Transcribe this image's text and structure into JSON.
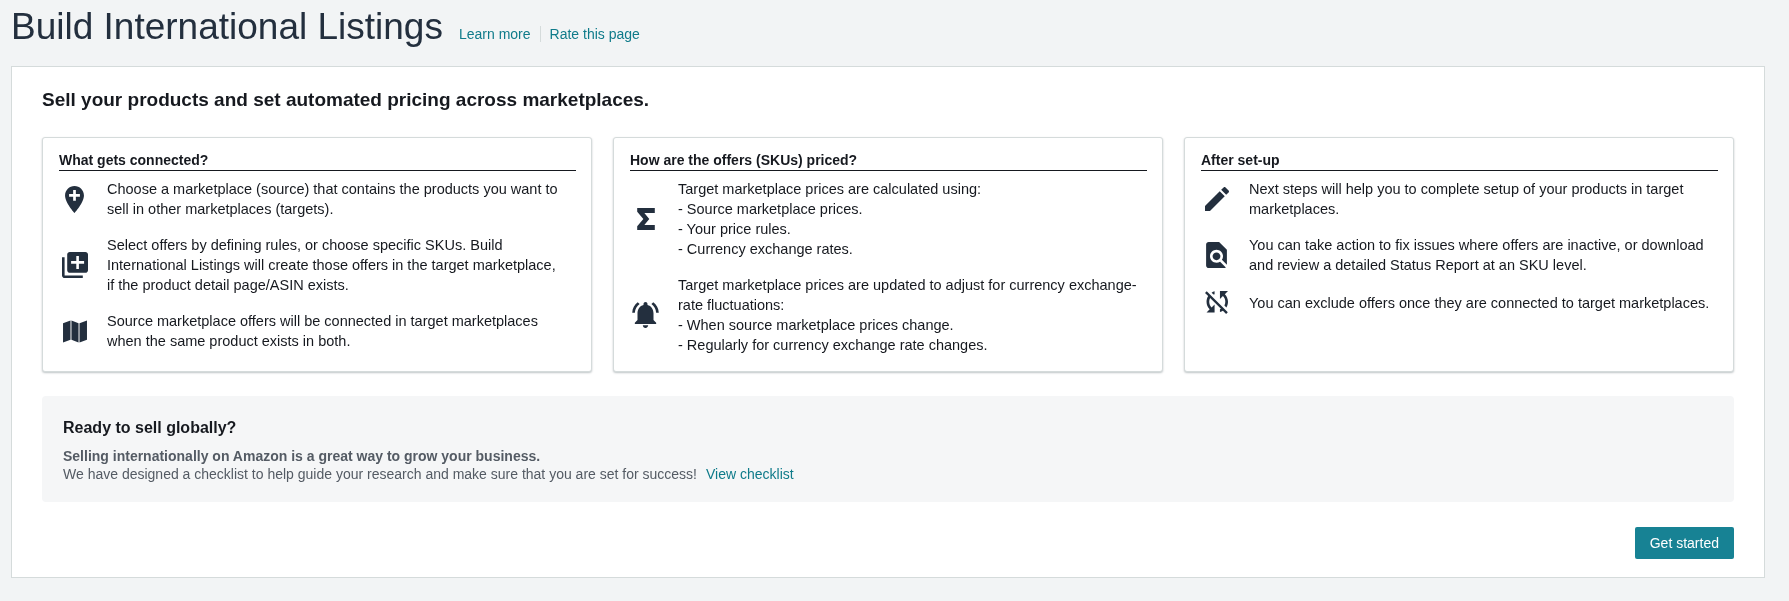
{
  "header": {
    "title": "Build International Listings",
    "links": [
      "Learn more",
      "Rate this page"
    ]
  },
  "panel": {
    "heading": "Sell your products and set automated pricing across marketplaces.",
    "cards": [
      {
        "title": "What gets connected?",
        "items": [
          {
            "text": "Choose a marketplace (source) that contains the products you want to sell in other marketplaces (targets)."
          },
          {
            "text": "Select offers by defining rules, or choose specific SKUs. Build International Listings will create those offers in the target marketplace, if the product detail page/ASIN exists."
          },
          {
            "text": "Source marketplace offers will be connected in target marketplaces when the same product exists in both."
          }
        ]
      },
      {
        "title": "How are the offers (SKUs) priced?",
        "items": [
          {
            "text": "Target marketplace prices are calculated using:",
            "points": [
              "- Source marketplace prices.",
              "- Your price rules.",
              "- Currency exchange rates."
            ]
          },
          {
            "text": "Target marketplace prices are updated to adjust for currency exchange-rate fluctuations:",
            "points": [
              "- When source marketplace prices change.",
              "- Regularly for currency exchange rate changes."
            ]
          }
        ]
      },
      {
        "title": "After set-up",
        "items": [
          {
            "text": "Next steps will help you to complete setup of your products in target marketplaces."
          },
          {
            "text": "You can take action to fix issues where offers are inactive, or download and review a detailed Status Report at an SKU level."
          },
          {
            "text": "You can exclude offers once they are connected to target marketplaces."
          }
        ]
      }
    ],
    "callout": {
      "title": "Ready to sell globally?",
      "lead": "Selling internationally on Amazon is a great way to grow your business.",
      "text": "We have designed a checklist to help guide your research and make sure that you are set for success!",
      "link": "View checklist"
    },
    "button": "Get started"
  }
}
